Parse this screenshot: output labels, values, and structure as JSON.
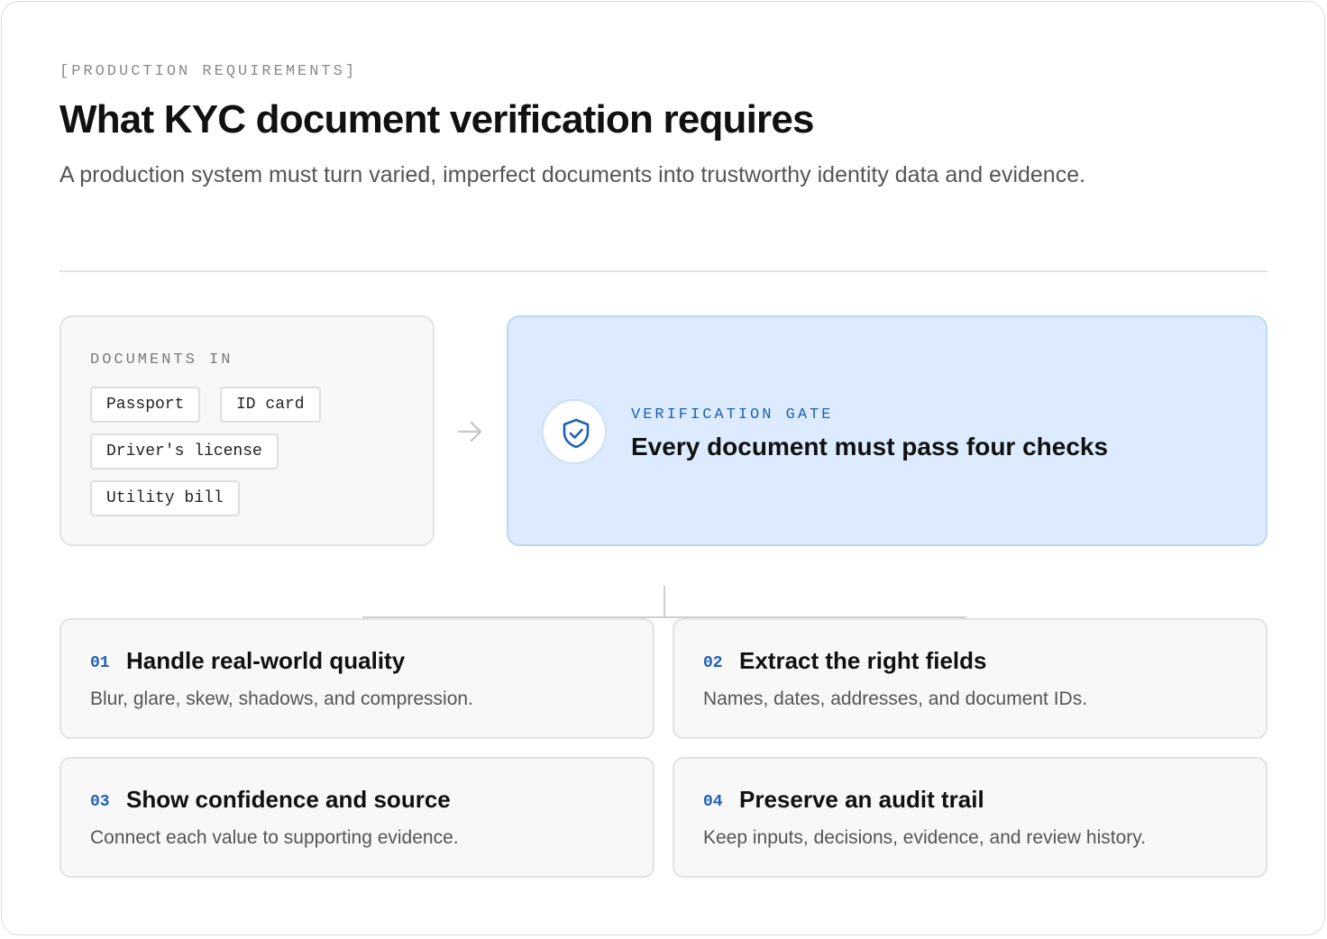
{
  "header": {
    "eyebrow": "[PRODUCTION REQUIREMENTS]",
    "title": "What KYC document verification requires",
    "subtitle": "A production system must turn varied, imperfect documents into trustworthy identity data and evidence."
  },
  "documents": {
    "label": "DOCUMENTS IN",
    "items": [
      "Passport",
      "ID card",
      "Driver's license",
      "Utility bill"
    ]
  },
  "gate": {
    "label": "VERIFICATION GATE",
    "heading": "Every document must pass four checks",
    "icon": "shield-check-icon"
  },
  "checks": [
    {
      "number": "01",
      "title": "Handle real-world quality",
      "description": "Blur, glare, skew, shadows, and compression."
    },
    {
      "number": "02",
      "title": "Extract the right fields",
      "description": "Names, dates, addresses, and document IDs."
    },
    {
      "number": "03",
      "title": "Show confidence and source",
      "description": "Connect each value to supporting evidence."
    },
    {
      "number": "04",
      "title": "Preserve an audit trail",
      "description": "Keep inputs, decisions, evidence, and review history."
    }
  ],
  "colors": {
    "accent": "#1f5fb8",
    "gate_background": "#dcebfd",
    "gate_border": "#bcd8f3",
    "card_background": "#f8f8f8"
  }
}
